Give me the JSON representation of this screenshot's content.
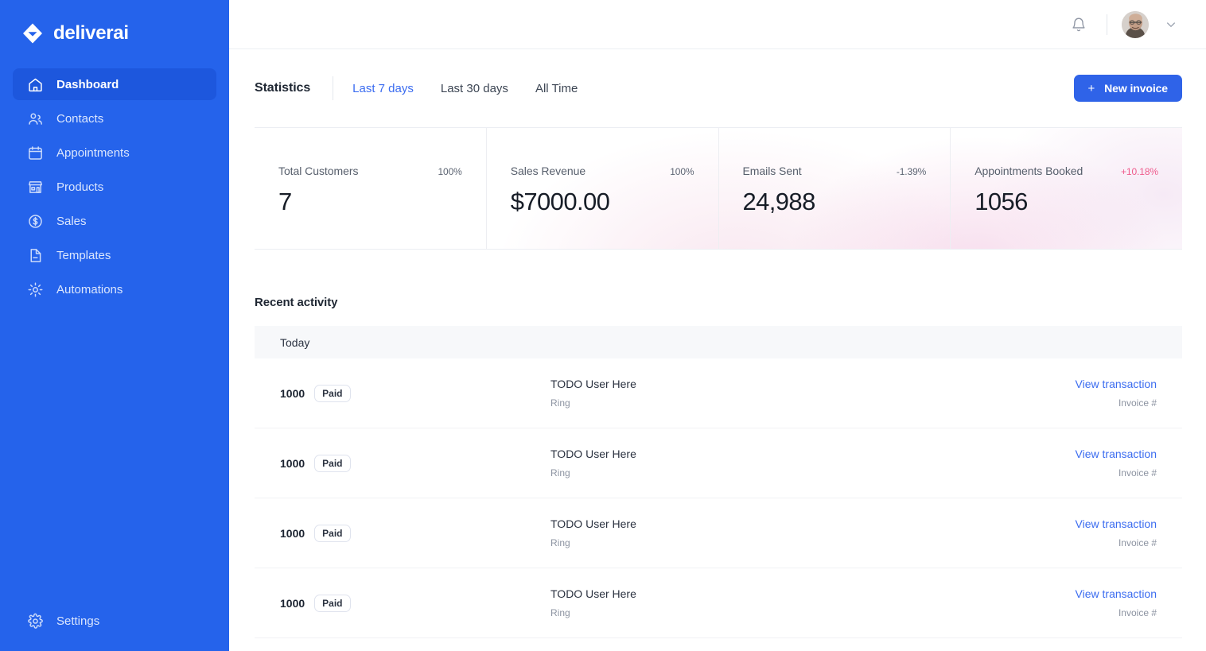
{
  "brand": {
    "name": "deliverai",
    "logo_icon": "diamond-logo-icon",
    "color": "#2563eb"
  },
  "sidebar": {
    "items": [
      {
        "label": "Dashboard",
        "icon": "home-icon",
        "active": true
      },
      {
        "label": "Contacts",
        "icon": "users-icon",
        "active": false
      },
      {
        "label": "Appointments",
        "icon": "calendar-icon",
        "active": false
      },
      {
        "label": "Products",
        "icon": "storefront-icon",
        "active": false
      },
      {
        "label": "Sales",
        "icon": "dollar-circle-icon",
        "active": false
      },
      {
        "label": "Templates",
        "icon": "document-icon",
        "active": false
      },
      {
        "label": "Automations",
        "icon": "gear-cog-icon",
        "active": false
      }
    ],
    "bottom": {
      "label": "Settings",
      "icon": "gear-icon"
    }
  },
  "topbar": {
    "notifications_icon": "bell-icon",
    "avatar_icon": "user-avatar",
    "dropdown_icon": "chevron-down-icon"
  },
  "statistics": {
    "title": "Statistics",
    "tabs": [
      {
        "label": "Last 7 days",
        "active": true
      },
      {
        "label": "Last 30 days",
        "active": false
      },
      {
        "label": "All Time",
        "active": false
      }
    ],
    "new_invoice_button": {
      "label": "New invoice",
      "icon": "plus-icon"
    },
    "cards": [
      {
        "label": "Total Customers",
        "delta": "100%",
        "delta_positive": false,
        "value": "7"
      },
      {
        "label": "Sales Revenue",
        "delta": "100%",
        "delta_positive": false,
        "value": "$7000.00"
      },
      {
        "label": "Emails Sent",
        "delta": "-1.39%",
        "delta_positive": false,
        "value": "24,988"
      },
      {
        "label": "Appointments Booked",
        "delta": "+10.18%",
        "delta_positive": true,
        "value": "1056"
      }
    ],
    "accent_positive_color": "#ef5b8c",
    "accent_link_color": "#3b6cf0"
  },
  "recent_activity": {
    "title": "Recent activity",
    "group_label": "Today",
    "rows": [
      {
        "amount": "1000",
        "status": "Paid",
        "user": "TODO User Here",
        "sub": "Ring",
        "action": "View transaction",
        "invoice": "Invoice #"
      },
      {
        "amount": "1000",
        "status": "Paid",
        "user": "TODO User Here",
        "sub": "Ring",
        "action": "View transaction",
        "invoice": "Invoice #"
      },
      {
        "amount": "1000",
        "status": "Paid",
        "user": "TODO User Here",
        "sub": "Ring",
        "action": "View transaction",
        "invoice": "Invoice #"
      },
      {
        "amount": "1000",
        "status": "Paid",
        "user": "TODO User Here",
        "sub": "Ring",
        "action": "View transaction",
        "invoice": "Invoice #"
      }
    ]
  }
}
